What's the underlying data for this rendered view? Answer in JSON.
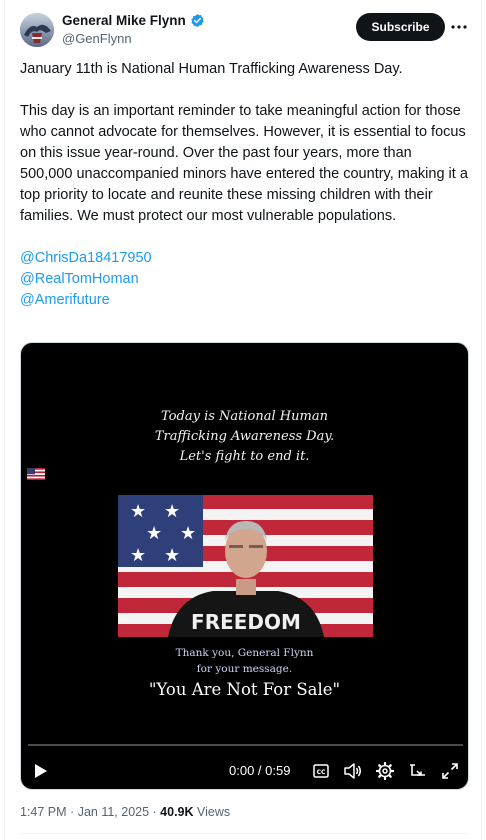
{
  "author": {
    "name": "General Mike Flynn",
    "handle": "@GenFlynn",
    "verified_color": "#1d9bf0"
  },
  "header": {
    "subscribe_label": "Subscribe",
    "more_icon": "more-horizontal-icon"
  },
  "tweet": {
    "paragraph1": "January 11th is National Human Trafficking Awareness Day.",
    "paragraph2": "This day is an important reminder to take meaningful action for those who cannot advocate for themselves. However, it is essential to focus on this issue year-round. Over the past four years, more than 500,000 unaccompanied minors have entered the country, making it a top priority to locate and reunite these missing children with their families. We must protect our most vulnerable populations.",
    "mentions": [
      "@ChrisDa18417950",
      "@RealTomHoman",
      "@Amerifuture"
    ]
  },
  "video": {
    "title_lines": [
      "Today is National Human",
      "Trafficking Awareness Day.",
      "Let's fight to end it."
    ],
    "shirt_text": "FREEDOM",
    "thanks_lines": [
      "Thank you, General Flynn",
      "for your message."
    ],
    "caption": "\"You Are Not For Sale\"",
    "time": "0:00 / 0:59",
    "progress": 0,
    "controls": [
      "play-icon",
      "captions-icon",
      "volume-icon",
      "settings-icon",
      "picture-in-picture-icon",
      "fullscreen-icon"
    ]
  },
  "meta": {
    "time": "1:47 PM",
    "date": "Jan 11, 2025",
    "views_count": "40.9K",
    "views_label": "Views"
  },
  "colors": {
    "accent": "#1d9bf0",
    "text": "#0f1419",
    "muted": "#536471"
  }
}
